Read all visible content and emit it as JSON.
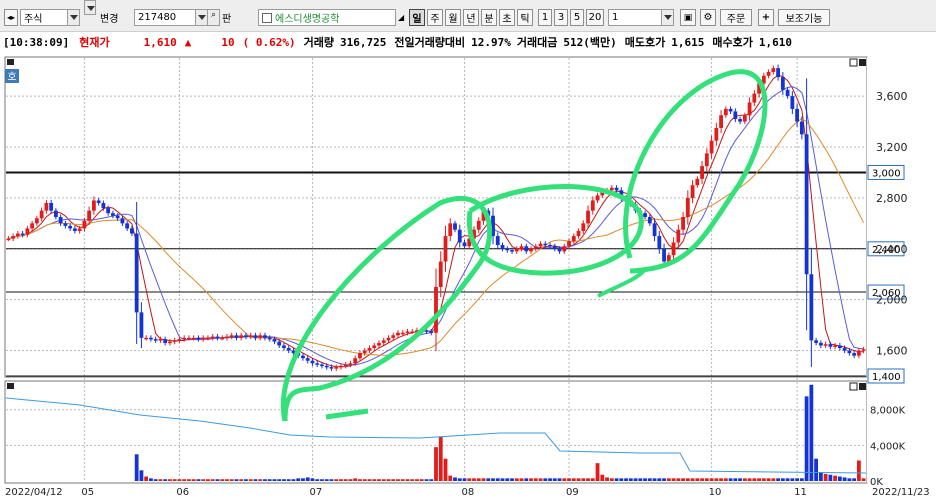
{
  "toolbar": {
    "market_select": "주식",
    "change_select": "변경",
    "stock_code": "217480",
    "pan_label": "판",
    "stock_name": "에스디생명공학",
    "period_buttons": [
      "일",
      "주",
      "월",
      "년",
      "분",
      "초",
      "틱"
    ],
    "active_period": "일",
    "interval_buttons": [
      "1",
      "3",
      "5",
      "20"
    ],
    "interval_value": "1",
    "order_button": "주문",
    "aux_button": "보조기능"
  },
  "quote": {
    "time": "[10:38:09]",
    "price_label": "현재가",
    "price": "1,610",
    "direction": "▲",
    "change": "10",
    "change_pct": "( 0.62%)",
    "volume_label": "거래량",
    "volume": "316,725",
    "prev_vol_label": "전일거래량대비",
    "prev_vol_ratio": "12.97%",
    "amount_label": "거래대금",
    "amount": "512(백만)",
    "ask_label": "매도호가",
    "ask": "1,615",
    "bid_label": "매수호가",
    "bid": "1,610"
  },
  "chart": {
    "corner_label": "호",
    "price_axis_labels": [
      "3,600",
      "3,200",
      "2,800",
      "2,400",
      "2,000",
      "1,600"
    ],
    "hline_badges": [
      "3,000",
      "2,400",
      "2,060",
      "1,400"
    ],
    "volume_axis_labels": [
      "8,000K",
      "4,000K",
      "0K"
    ],
    "date_labels": [
      "2022/04/12",
      "05",
      "06",
      "07",
      "08",
      "09",
      "10",
      "11",
      "2022/11/23"
    ],
    "colors": {
      "up": "#e21b1b",
      "down": "#1433d6",
      "ma_short": "#c81414",
      "ma_mid": "#5a5adc",
      "ma_long": "#e08a2a",
      "volume_line": "#3a9be0",
      "annotation": "#33e07a",
      "grid": "#b8b8b8"
    }
  },
  "chart_data": {
    "type": "candlestick",
    "price_range": [
      1400,
      3900
    ],
    "hlines": [
      3000,
      2400,
      2060,
      1400
    ],
    "month_boundaries": [
      "05",
      "06",
      "07",
      "08",
      "09",
      "10",
      "11"
    ],
    "close_series": [
      2480,
      2500,
      2520,
      2510,
      2560,
      2600,
      2640,
      2700,
      2760,
      2700,
      2650,
      2600,
      2580,
      2560,
      2540,
      2560,
      2620,
      2700,
      2780,
      2760,
      2720,
      2680,
      2660,
      2640,
      2600,
      2560,
      2520,
      1900,
      1700,
      1700,
      1690,
      1680,
      1690,
      1660,
      1670,
      1680,
      1690,
      1700,
      1700,
      1700,
      1690,
      1700,
      1700,
      1710,
      1700,
      1700,
      1710,
      1720,
      1700,
      1720,
      1710,
      1720,
      1700,
      1720,
      1700,
      1690,
      1670,
      1640,
      1620,
      1600,
      1580,
      1560,
      1540,
      1520,
      1500,
      1490,
      1480,
      1470,
      1460,
      1470,
      1480,
      1490,
      1500,
      1540,
      1580,
      1600,
      1620,
      1640,
      1660,
      1680,
      1700,
      1720,
      1740,
      1740,
      1750,
      1750,
      1760,
      1760,
      1750,
      1740,
      2100,
      2300,
      2500,
      2600,
      2550,
      2450,
      2420,
      2480,
      2550,
      2620,
      2700,
      2660,
      2500,
      2430,
      2400,
      2390,
      2380,
      2400,
      2420,
      2380,
      2400,
      2420,
      2440,
      2430,
      2420,
      2400,
      2380,
      2420,
      2460,
      2500,
      2540,
      2600,
      2700,
      2780,
      2820,
      2850,
      2860,
      2880,
      2860,
      2800,
      2780,
      2750,
      2700,
      2680,
      2650,
      2600,
      2500,
      2400,
      2300,
      2350,
      2450,
      2550,
      2650,
      2800,
      2900,
      2950,
      3050,
      3150,
      3250,
      3350,
      3450,
      3500,
      3480,
      3420,
      3400,
      3450,
      3550,
      3620,
      3700,
      3760,
      3790,
      3820,
      3750,
      3650,
      3600,
      3500,
      3400,
      3300,
      2200,
      1680,
      1660,
      1640,
      1650,
      1630,
      1640,
      1620,
      1600,
      1580,
      1560,
      1600,
      1610
    ],
    "volume_series_k": [
      0,
      0,
      0,
      0,
      0,
      0,
      0,
      0,
      0,
      0,
      0,
      0,
      0,
      0,
      0,
      0,
      0,
      0,
      0,
      0,
      0,
      0,
      0,
      0,
      0,
      0,
      0,
      3000,
      1200,
      500,
      300,
      200,
      200,
      200,
      200,
      200,
      200,
      200,
      200,
      200,
      200,
      200,
      200,
      200,
      200,
      200,
      200,
      200,
      200,
      200,
      200,
      200,
      200,
      200,
      200,
      200,
      200,
      200,
      200,
      200,
      200,
      300,
      300,
      400,
      300,
      200,
      200,
      200,
      200,
      200,
      200,
      200,
      200,
      300,
      200,
      200,
      200,
      200,
      200,
      200,
      200,
      200,
      200,
      200,
      200,
      200,
      200,
      200,
      200,
      200,
      3800,
      5000,
      2500,
      600,
      400,
      300,
      300,
      300,
      300,
      300,
      300,
      300,
      300,
      300,
      300,
      300,
      300,
      300,
      300,
      300,
      300,
      300,
      300,
      300,
      300,
      300,
      300,
      300,
      300,
      300,
      300,
      300,
      300,
      300,
      2000,
      700,
      400,
      300,
      300,
      300,
      300,
      300,
      300,
      300,
      300,
      300,
      300,
      300,
      300,
      300,
      300,
      300,
      300,
      300,
      300,
      300,
      300,
      300,
      300,
      300,
      300,
      300,
      300,
      300,
      300,
      300,
      300,
      300,
      300,
      300,
      300,
      300,
      300,
      300,
      300,
      300,
      300,
      300,
      9500,
      10800,
      2500,
      1000,
      800,
      700,
      600,
      500,
      400,
      300,
      300,
      2300,
      300
    ]
  }
}
